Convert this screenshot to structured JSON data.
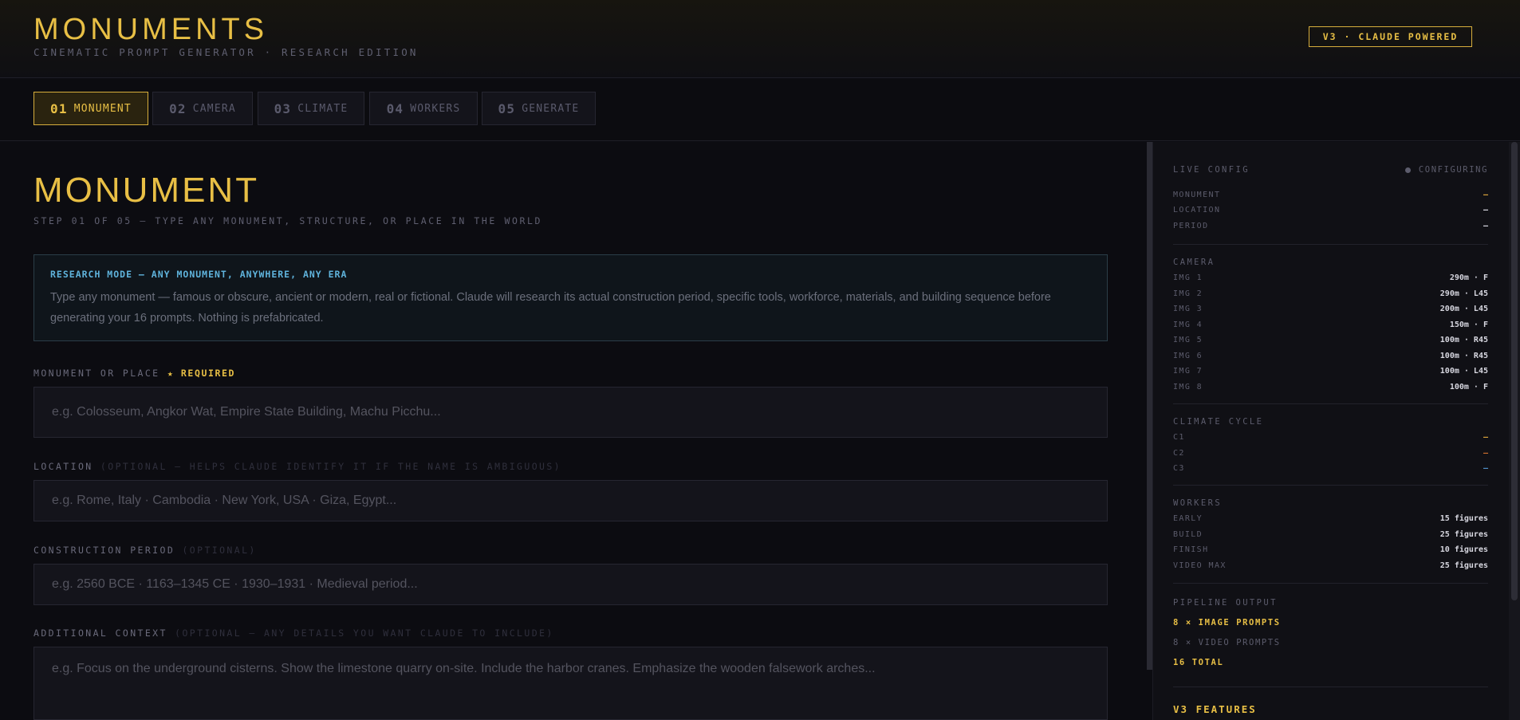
{
  "header": {
    "title": "MONUMENTS",
    "subtitle": "CINEMATIC PROMPT GENERATOR · RESEARCH EDITION",
    "badge": "V3 · CLAUDE POWERED"
  },
  "tabs": [
    {
      "num": "01",
      "label": "MONUMENT",
      "active": true
    },
    {
      "num": "02",
      "label": "CAMERA",
      "active": false
    },
    {
      "num": "03",
      "label": "CLIMATE",
      "active": false
    },
    {
      "num": "04",
      "label": "WORKERS",
      "active": false
    },
    {
      "num": "05",
      "label": "GENERATE",
      "active": false
    }
  ],
  "main": {
    "title": "MONUMENT",
    "step": "STEP 01 OF 05 — TYPE ANY MONUMENT, STRUCTURE, OR PLACE IN THE WORLD",
    "info": {
      "heading": "RESEARCH MODE — ANY MONUMENT, ANYWHERE, ANY ERA",
      "text": "Type any monument — famous or obscure, ancient or modern, real or fictional. Claude will research its actual construction period, specific tools, workforce, materials, and building sequence before generating your 16 prompts. Nothing is prefabricated."
    },
    "fields": {
      "monument": {
        "label": "MONUMENT OR PLACE",
        "required": "★ REQUIRED",
        "placeholder": "e.g. Colosseum, Angkor Wat, Empire State Building, Machu Picchu..."
      },
      "location": {
        "label": "LOCATION",
        "hint": "(OPTIONAL — HELPS CLAUDE IDENTIFY IT IF THE NAME IS AMBIGUOUS)",
        "placeholder": "e.g. Rome, Italy · Cambodia · New York, USA · Giza, Egypt..."
      },
      "period": {
        "label": "CONSTRUCTION PERIOD",
        "hint": "(OPTIONAL)",
        "placeholder": "e.g. 2560 BCE · 1163–1345 CE · 1930–1931 · Medieval period..."
      },
      "context": {
        "label": "ADDITIONAL CONTEXT",
        "hint": "(OPTIONAL — ANY DETAILS YOU WANT CLAUDE TO INCLUDE)",
        "placeholder": "e.g. Focus on the underground cisterns. Show the limestone quarry on-site. Include the harbor cranes. Emphasize the wooden falsework arches..."
      }
    }
  },
  "sidebar": {
    "heading": "LIVE CONFIG",
    "status": "CONFIGURING",
    "config": [
      {
        "k": "MONUMENT",
        "v": "—"
      },
      {
        "k": "LOCATION",
        "v": "—"
      },
      {
        "k": "PERIOD",
        "v": "—"
      }
    ],
    "camera_heading": "CAMERA",
    "camera": [
      {
        "k": "IMG 1",
        "v": "290m · F"
      },
      {
        "k": "IMG 2",
        "v": "290m · L45"
      },
      {
        "k": "IMG 3",
        "v": "200m · L45"
      },
      {
        "k": "IMG 4",
        "v": "150m · F"
      },
      {
        "k": "IMG 5",
        "v": "100m · R45"
      },
      {
        "k": "IMG 6",
        "v": "100m · R45"
      },
      {
        "k": "IMG 7",
        "v": "100m · L45"
      },
      {
        "k": "IMG 8",
        "v": "100m · F"
      }
    ],
    "climate_heading": "CLIMATE CYCLE",
    "climate": [
      {
        "k": "C1",
        "v": "—"
      },
      {
        "k": "C2",
        "v": "—"
      },
      {
        "k": "C3",
        "v": "—"
      }
    ],
    "workers_heading": "WORKERS",
    "workers": [
      {
        "k": "EARLY",
        "v": "15 figures"
      },
      {
        "k": "BUILD",
        "v": "25 figures"
      },
      {
        "k": "FINISH",
        "v": "10 figures"
      },
      {
        "k": "VIDEO MAX",
        "v": "25 figures"
      }
    ],
    "pipeline_heading": "PIPELINE OUTPUT",
    "pipeline": {
      "image": "8 × IMAGE PROMPTS",
      "video": "8 × VIDEO PROMPTS",
      "total": "16 TOTAL"
    },
    "features_heading": "V3 FEATURES"
  }
}
